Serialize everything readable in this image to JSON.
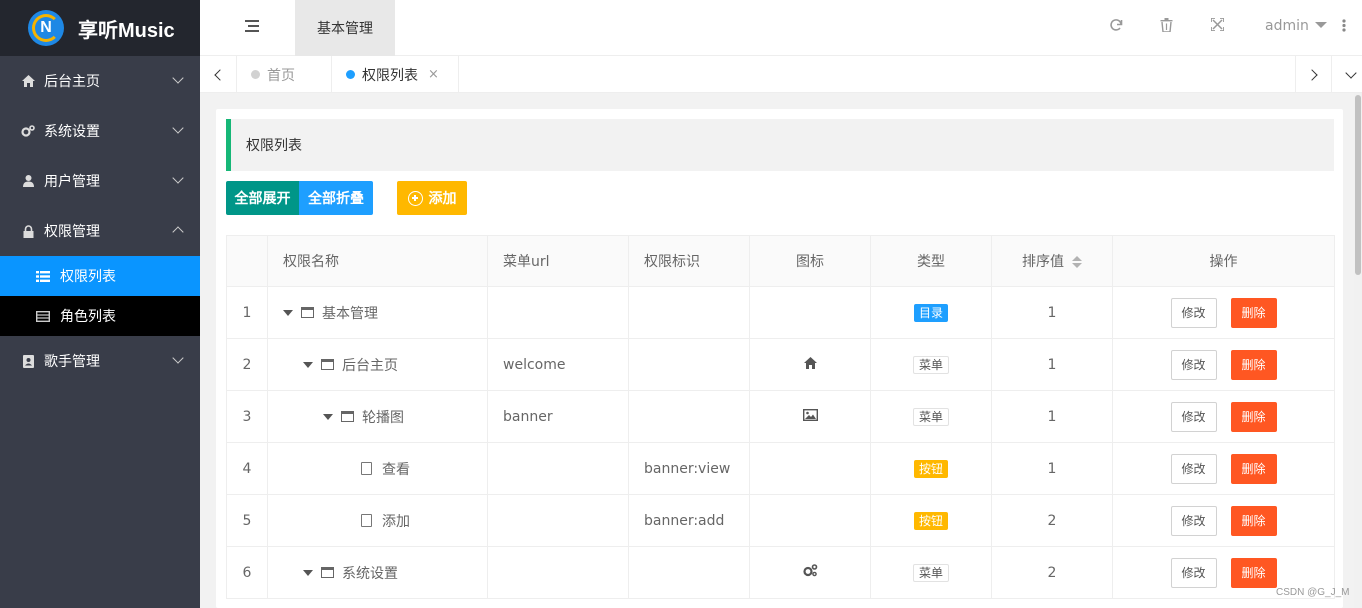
{
  "app": {
    "title": "享听Music",
    "logo_letter": "N"
  },
  "sidebar": {
    "items": [
      {
        "label": "后台主页",
        "icon": "home-icon"
      },
      {
        "label": "系统设置",
        "icon": "gears-icon"
      },
      {
        "label": "用户管理",
        "icon": "user-icon"
      },
      {
        "label": "权限管理",
        "icon": "lock-icon"
      },
      {
        "label": "歌手管理",
        "icon": "address-book-icon"
      }
    ],
    "sub_items": [
      {
        "label": "权限列表",
        "icon": "list-icon",
        "active": true
      },
      {
        "label": "角色列表",
        "icon": "table-icon",
        "active": false
      }
    ]
  },
  "header": {
    "module_tab": "基本管理",
    "user": "admin"
  },
  "tabs": [
    {
      "label": "首页",
      "dot_color": "#d2d2d2"
    },
    {
      "label": "权限列表",
      "dot_color": "#1e9fff",
      "close": "×"
    }
  ],
  "page": {
    "quote": "权限列表",
    "buttons": {
      "expand_all": "全部展开",
      "collapse_all": "全部折叠",
      "add": "添加"
    }
  },
  "table": {
    "headers": [
      "",
      "权限名称",
      "菜单url",
      "权限标识",
      "图标",
      "类型",
      "排序值",
      "操作"
    ],
    "rows": [
      {
        "index": "1",
        "name": "基本管理",
        "level": 0,
        "node": "folder",
        "url": "",
        "perm": "",
        "icon": "",
        "type": "目录",
        "type_style": "blue",
        "sort": "1"
      },
      {
        "index": "2",
        "name": "后台主页",
        "level": 1,
        "node": "folder",
        "url": "welcome",
        "perm": "",
        "icon": "home-icon",
        "type": "菜单",
        "type_style": "white",
        "sort": "1"
      },
      {
        "index": "3",
        "name": "轮播图",
        "level": 2,
        "node": "folder",
        "url": "banner",
        "perm": "",
        "icon": "picture-icon",
        "type": "菜单",
        "type_style": "white",
        "sort": "1"
      },
      {
        "index": "4",
        "name": "查看",
        "level": 3,
        "node": "file",
        "url": "",
        "perm": "banner:view",
        "icon": "",
        "type": "按钮",
        "type_style": "yellow",
        "sort": "1"
      },
      {
        "index": "5",
        "name": "添加",
        "level": 3,
        "node": "file",
        "url": "",
        "perm": "banner:add",
        "icon": "",
        "type": "按钮",
        "type_style": "yellow",
        "sort": "2"
      },
      {
        "index": "6",
        "name": "系统设置",
        "level": 1,
        "node": "folder",
        "url": "",
        "perm": "",
        "icon": "gears-icon",
        "type": "菜单",
        "type_style": "white",
        "sort": "2"
      }
    ],
    "edit_label": "修改",
    "delete_label": "删除"
  },
  "watermark": "CSDN @G_J_M",
  "colors": {
    "sidebar": "#393d49",
    "active": "#0a95ff",
    "green": "#009688",
    "blue": "#1e9fff",
    "yellow": "#ffb800",
    "danger": "#ff5722"
  }
}
